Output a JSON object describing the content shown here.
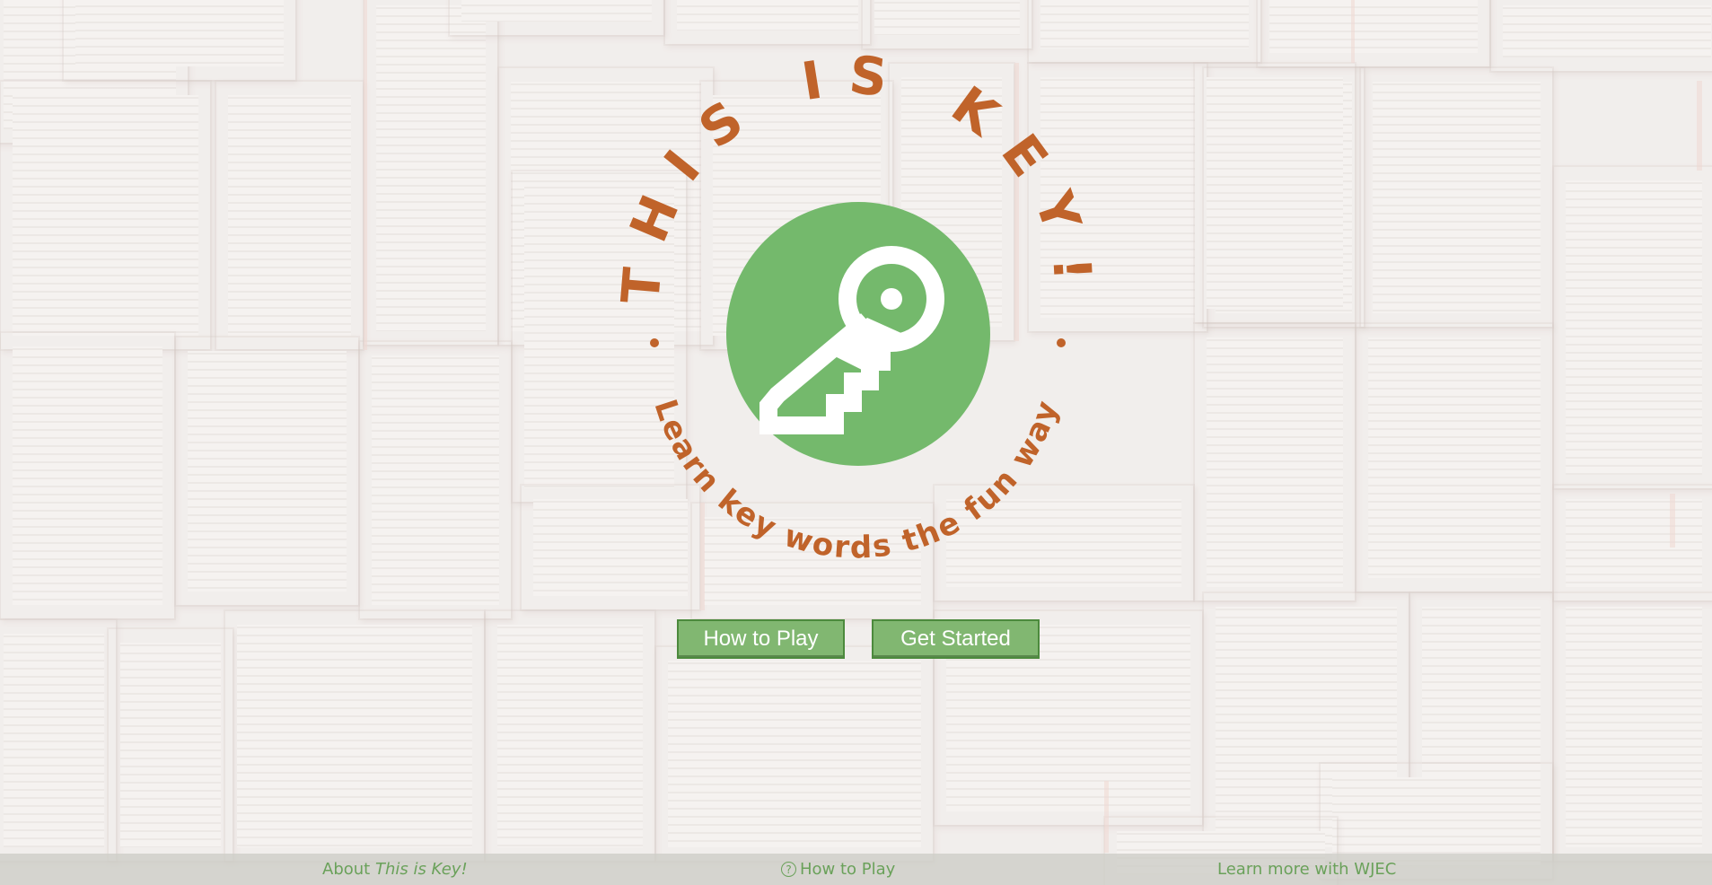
{
  "app": {
    "title": "This is Key!",
    "tagline": "Learn key words the fun way"
  },
  "logo": {
    "title_text": "THIS IS KEY!",
    "subtitle_text": "Learn key words the fun way",
    "icon": "key-icon",
    "colors": {
      "circle": "#74b96c",
      "text": "#c0632a",
      "key": "#ffffff"
    }
  },
  "buttons": {
    "how_to_play": "How to Play",
    "get_started": "Get Started"
  },
  "footer": {
    "about_prefix": "About ",
    "about_title": "This is Key!",
    "how_to_play": "How to Play",
    "help_icon": "?",
    "learn_more": "Learn more with WJEC"
  }
}
